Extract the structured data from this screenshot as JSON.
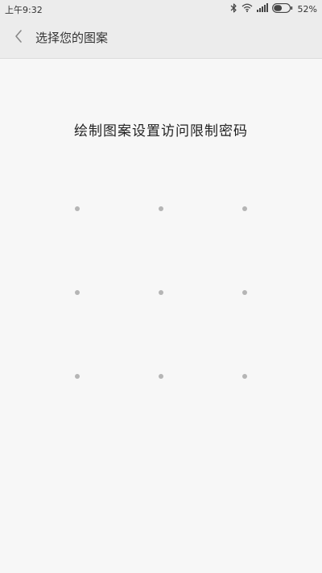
{
  "status_bar": {
    "time": "上午9:32",
    "battery_percent": "52%",
    "battery_level": 0.52,
    "icons": [
      "bluetooth-icon",
      "wifi-icon",
      "signal-icon",
      "battery-icon"
    ]
  },
  "header": {
    "back_icon": "chevron-left-icon",
    "title": "选择您的图案"
  },
  "main": {
    "prompt": "绘制图案设置访问限制密码",
    "pattern": {
      "rows": 3,
      "cols": 3,
      "dot_color": "#b5b5b5"
    }
  },
  "colors": {
    "background": "#f7f7f7",
    "bar": "#ececec",
    "text": "#333333"
  }
}
